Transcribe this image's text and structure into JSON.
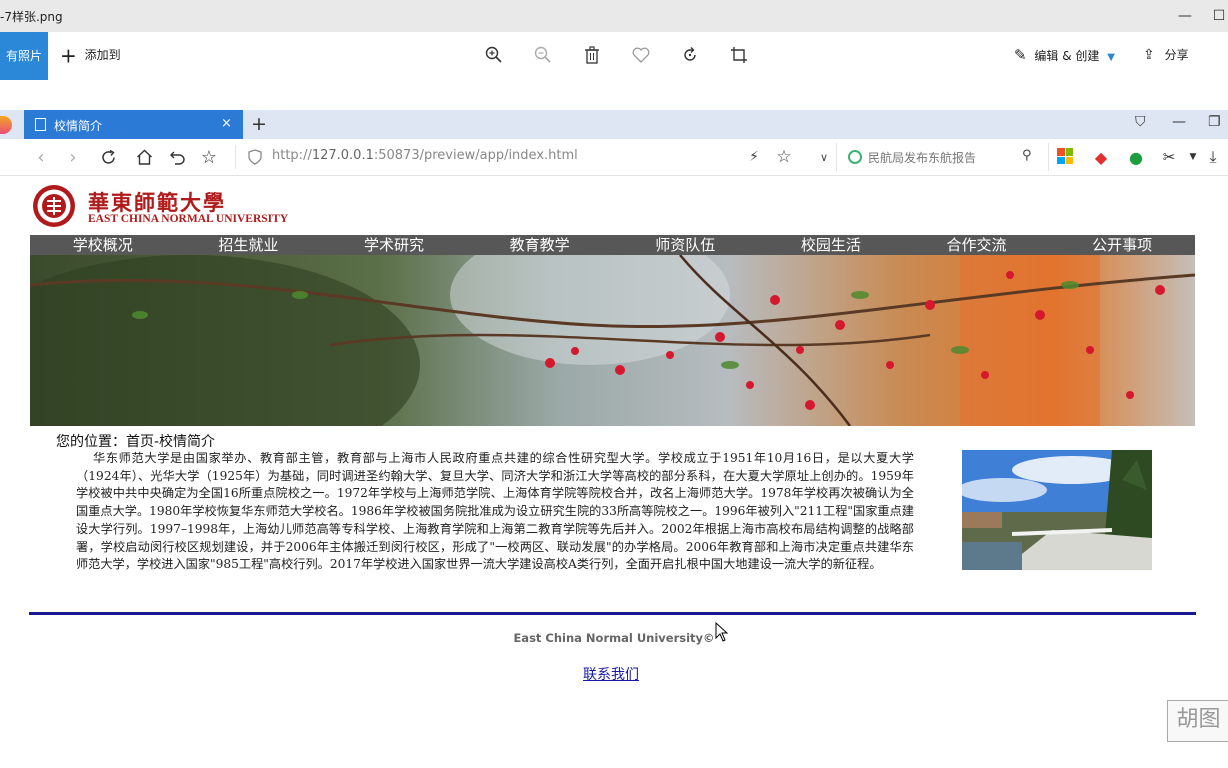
{
  "viewer": {
    "filename": "-7样张.png",
    "all_photos_label": "有照片",
    "add_to_label": "添加到",
    "edit_create_label": "编辑 & 创建",
    "share_label": "分享",
    "min_glyph": "—",
    "max_glyph": "☐"
  },
  "browser": {
    "tab_title": "校情简介",
    "tab_close": "×",
    "new_tab": "+",
    "url_prefix": "http://",
    "url_host": "127.0.0.1",
    "url_rest": ":50873/preview/app/index.html",
    "search_placeholder": "民航局发布东航报告"
  },
  "page": {
    "logo_cn": "華東師範大學",
    "logo_en": "EAST CHINA NORMAL UNIVERSITY",
    "nav": [
      "学校概况",
      "招生就业",
      "学术研究",
      "教育教学",
      "师资队伍",
      "校园生活",
      "合作交流",
      "公开事项"
    ],
    "breadcrumb": "您的位置：首页-校情简介",
    "intro": "华东师范大学是由国家举办、教育部主管，教育部与上海市人民政府重点共建的综合性研究型大学。学校成立于1951年10月16日，是以大夏大学（1924年）、光华大学（1925年）为基础，同时调进圣约翰大学、复旦大学、同济大学和浙江大学等高校的部分系科，在大夏大学原址上创办的。1959年学校被中共中央确定为全国16所重点院校之一。1972年学校与上海师范学院、上海体育学院等院校合并，改名上海师范大学。1978年学校再次被确认为全国重点大学。1980年学校恢复华东师范大学校名。1986年学校被国务院批准成为设立研究生院的33所高等院校之一。1996年被列入\"211工程\"国家重点建设大学行列。1997–1998年，上海幼儿师范高等专科学校、上海教育学院和上海第二教育学院等先后并入。2002年根据上海市高校布局结构调整的战略部署，学校启动闵行校区规划建设，并于2006年主体搬迁到闵行校区，形成了\"一校两区、联动发展\"的办学格局。2006年教育部和上海市决定重点共建华东师范大学，学校进入国家\"985工程\"高校行列。2017年学校进入国家世界一流大学建设高校A类行列，全面开启扎根中国大地建设一流大学的新征程。",
    "footer": "East China Normal University©",
    "contact": "联系我们"
  },
  "watermark": "胡图",
  "colors": {
    "accent": "#2b88d8",
    "nav_bg": "#575757",
    "logo_red": "#b01a1a",
    "divider": "#1a1a8f"
  }
}
